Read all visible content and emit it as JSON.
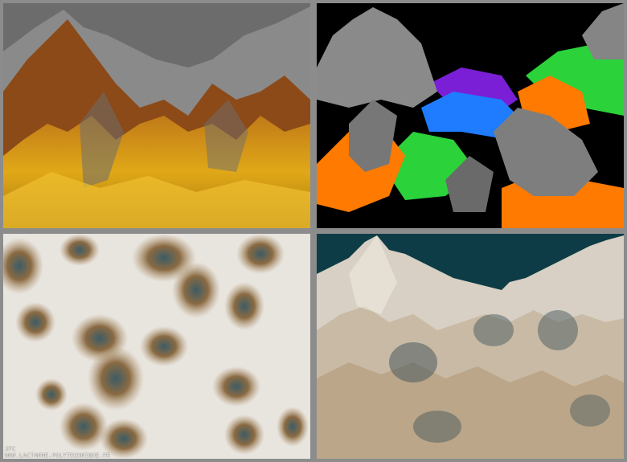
{
  "credit": {
    "initials": "JFC",
    "url": "WWW.LACTAMME.POLYTECHNIQUE.FR"
  },
  "panels": [
    {
      "name": "golden-mountains",
      "sky": "#6e6e6e",
      "palette": [
        "#d9a21b",
        "#b86a16",
        "#7a7a7a"
      ]
    },
    {
      "name": "rainbow-terrain",
      "sky": "#000000",
      "palette": [
        "#8a8a8a",
        "#ff7a00",
        "#2bd23a",
        "#1f7cff",
        "#7a1fd6"
      ]
    },
    {
      "name": "snowy-top-view",
      "palette": [
        "#e9e6e1",
        "#9a7a52",
        "#3c5c66"
      ]
    },
    {
      "name": "snowy-mountains",
      "sky": "#0e3c46",
      "palette": [
        "#e6e0d6",
        "#9a7a52",
        "#3c5c66"
      ]
    }
  ]
}
